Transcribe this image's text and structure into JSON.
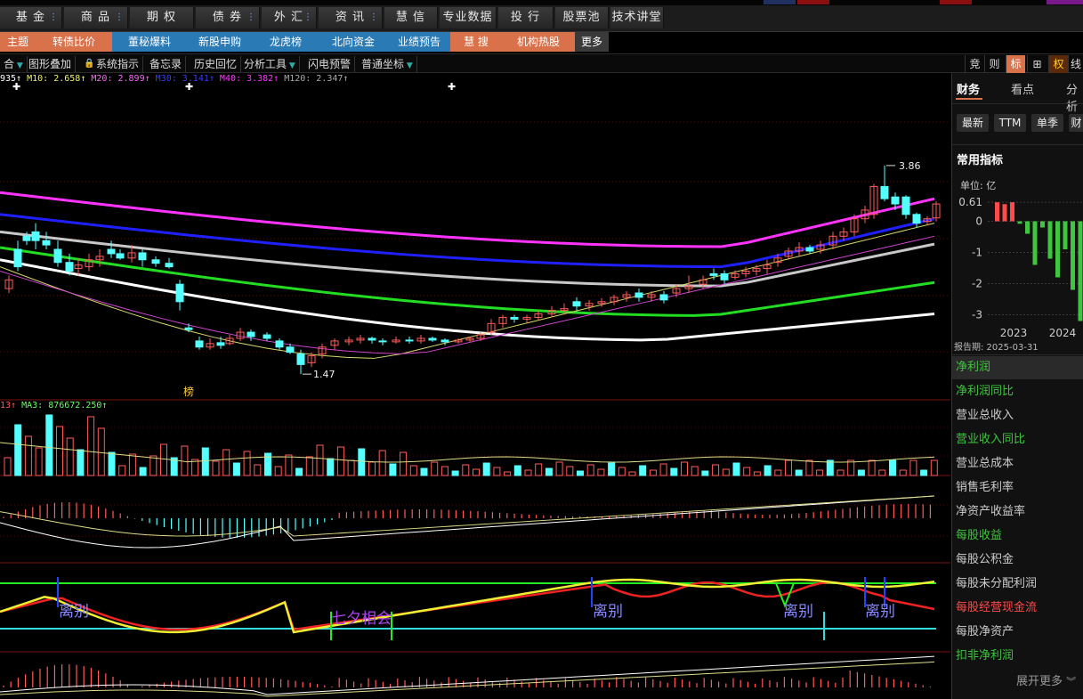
{
  "top_nav": {
    "items": [
      {
        "label": "基 金",
        "dd": true
      },
      {
        "label": "商 品",
        "dd": true
      },
      {
        "label": "期 权",
        "dd": false
      },
      {
        "label": "债 券",
        "dd": true
      },
      {
        "label": "外 汇",
        "dd": true
      },
      {
        "label": "资 讯",
        "dd": true
      },
      {
        "label": "慧 信",
        "dd": false
      },
      {
        "label": "专业数据",
        "dd": false
      },
      {
        "label": "投 行",
        "dd": false
      },
      {
        "label": "股票池",
        "dd": false
      },
      {
        "label": "技术讲堂",
        "dd": false
      }
    ]
  },
  "sub_nav": {
    "items": [
      {
        "label": "主题",
        "style": "orange"
      },
      {
        "label": "转债比价",
        "style": "orange"
      },
      {
        "label": "董秘爆料",
        "style": "blue"
      },
      {
        "label": "新股申购",
        "style": "blue"
      },
      {
        "label": "龙虎榜",
        "style": "blue"
      },
      {
        "label": "北向资金",
        "style": "blue"
      },
      {
        "label": "业绩预告",
        "style": "blue"
      },
      {
        "label": "慧 搜",
        "style": "orange"
      },
      {
        "label": "机构热股",
        "style": "orange"
      },
      {
        "label": "更多",
        "style": "gray"
      }
    ]
  },
  "toolbar": {
    "items": [
      "合",
      "图形叠加",
      "系统指示",
      "备忘录",
      "历史回忆",
      "分析工具",
      "闪电预警",
      "普通坐标"
    ],
    "right_items": [
      "竞",
      "则",
      "标",
      "⊞",
      "权",
      "线"
    ]
  },
  "price_panel": {
    "legend": {
      "ma5": "935↑",
      "ma10": "M10: 2.658↑",
      "ma20": "M20: 2.899↑",
      "ma30": "M30: 3.141↑",
      "ma40": "M40: 3.382↑",
      "ma120": "M120: 2.347↑"
    },
    "high_label": "3.86",
    "low_label": "1.47",
    "marker_label": "榜",
    "colors": {
      "up": "#ff5b5b",
      "down": "#54ffff",
      "ma_pink": "#ff33ff",
      "ma_blue": "#2020ff",
      "ma_gray": "#c8c8c8",
      "ma_green": "#22dd22",
      "ma_white": "#ffffff"
    }
  },
  "volume_panel": {
    "legend": {
      "vol": "13↑",
      "ma3": "MA3: 876672.250↑"
    }
  },
  "signal_panel": {
    "labels": [
      "离别",
      "七夕相会",
      "离别",
      "离别",
      "离别"
    ]
  },
  "right_panel": {
    "tabs": [
      "财务",
      "看点",
      "分析"
    ],
    "buttons": [
      "最新",
      "TTM",
      "单季",
      "财"
    ],
    "section_title": "常用指标",
    "unit": "单位: 亿",
    "chart_data": {
      "type": "bar",
      "title": "",
      "ylabel": "单位: 亿",
      "yticks": [
        "0.61",
        "0",
        "-1",
        "-2",
        "-3"
      ],
      "ylim": [
        -3.3,
        0.7
      ],
      "xticks": [
        "2023",
        "2024"
      ],
      "values": [
        0.61,
        0.55,
        0.61,
        -0.08,
        -0.4,
        -1.4,
        -0.2,
        -1.2,
        -1.8,
        -0.9,
        -2.2,
        -3.2
      ],
      "colors_positive": "#ff4a4a",
      "colors_negative": "#3fc53f"
    },
    "report_period": "报告期:  2025-03-31",
    "metrics": [
      {
        "label": "净利润",
        "color": "#3fc53f",
        "selected": true
      },
      {
        "label": "净利润同比",
        "color": "#3fc53f"
      },
      {
        "label": "营业总收入",
        "color": "#cccccc"
      },
      {
        "label": "营业收入同比",
        "color": "#3fc53f"
      },
      {
        "label": "营业总成本",
        "color": "#cccccc"
      },
      {
        "label": "销售毛利率",
        "color": "#cccccc"
      },
      {
        "label": "净资产收益率",
        "color": "#cccccc"
      },
      {
        "label": "每股收益",
        "color": "#3fc53f"
      },
      {
        "label": "每股公积金",
        "color": "#cccccc"
      },
      {
        "label": "每股未分配利润",
        "color": "#cccccc"
      },
      {
        "label": "每股经营现金流",
        "color": "#ff4a4a"
      },
      {
        "label": "每股净资产",
        "color": "#cccccc"
      },
      {
        "label": "扣非净利润",
        "color": "#3fc53f"
      }
    ],
    "expand_more": "展开更多"
  }
}
